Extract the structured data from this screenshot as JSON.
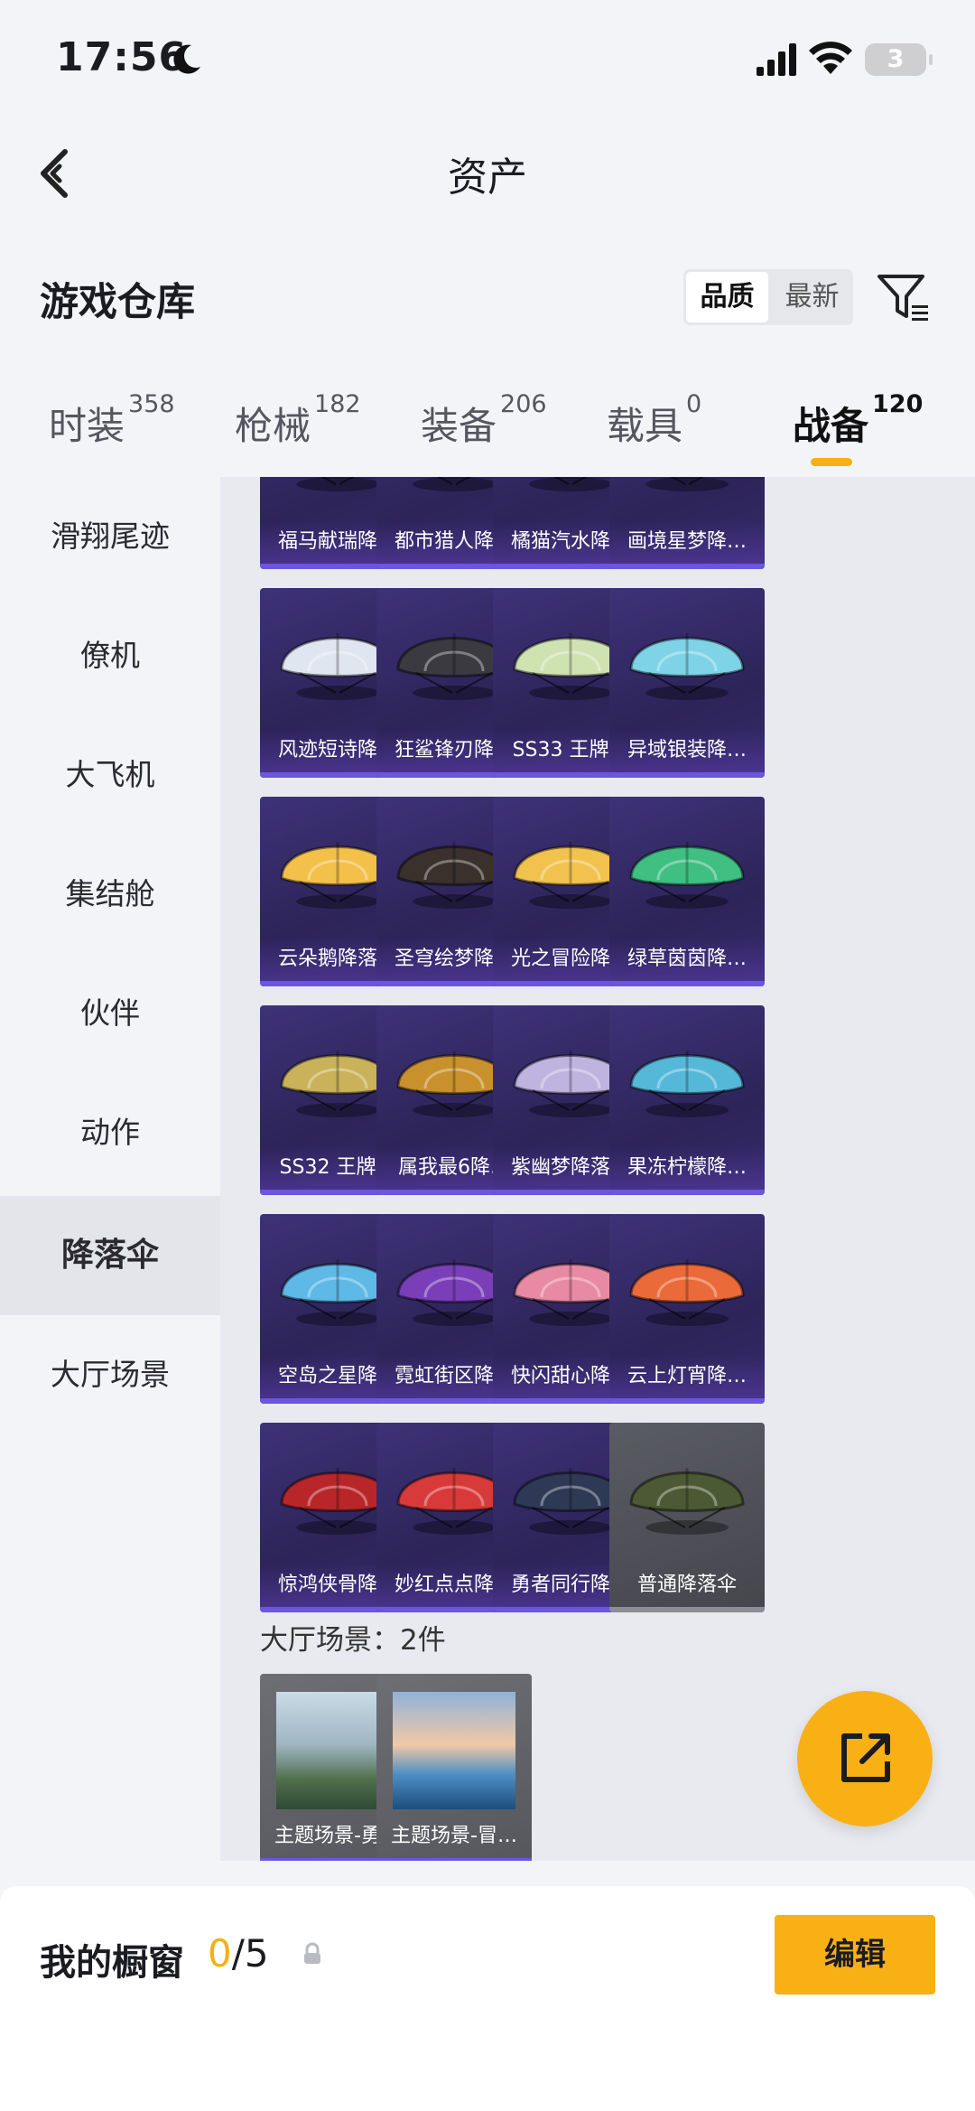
{
  "status_bar": {
    "time": "17:56",
    "battery": "3"
  },
  "nav": {
    "title": "资产"
  },
  "warehouse": {
    "title": "游戏仓库",
    "sort_options": [
      "品质",
      "最新"
    ],
    "sort_selected": "品质"
  },
  "tabs": [
    {
      "label": "时装",
      "count": "358"
    },
    {
      "label": "枪械",
      "count": "182"
    },
    {
      "label": "装备",
      "count": "206"
    },
    {
      "label": "载具",
      "count": "0"
    },
    {
      "label": "战备",
      "count": "120",
      "active": true
    }
  ],
  "sidebar": {
    "items": [
      {
        "label": "滑翔尾迹"
      },
      {
        "label": "僚机"
      },
      {
        "label": "大飞机"
      },
      {
        "label": "集结舱"
      },
      {
        "label": "伙伴"
      },
      {
        "label": "动作"
      },
      {
        "label": "降落伞",
        "active": true
      },
      {
        "label": "大厅场景"
      }
    ]
  },
  "parachutes": {
    "items": [
      {
        "name": "福马献瑞降…",
        "color": "#d9903a"
      },
      {
        "name": "都市猎人降…",
        "color": "#454048"
      },
      {
        "name": "橘猫汽水降…",
        "color": "#e0e0e8"
      },
      {
        "name": "画境星梦降…",
        "color": "#c48a4a"
      },
      {
        "name": "风迹短诗降…",
        "color": "#dfe6ef"
      },
      {
        "name": "狂鲨锋刃降…",
        "color": "#3b3a40"
      },
      {
        "name": "SS33 王牌…",
        "color": "#cfe3b2"
      },
      {
        "name": "异域银装降…",
        "color": "#7fd3e6"
      },
      {
        "name": "云朵鹅降落伞",
        "color": "#f3c04a"
      },
      {
        "name": "圣穹绘梦降…",
        "color": "#3a302c"
      },
      {
        "name": "光之冒险降…",
        "color": "#f2c24e"
      },
      {
        "name": "绿草茵茵降…",
        "color": "#3fbf82"
      },
      {
        "name": "SS32 王牌…",
        "color": "#c9b25a"
      },
      {
        "name": "属我最6降…",
        "color": "#c9912e"
      },
      {
        "name": "紫幽梦降落伞",
        "color": "#bfb4e0"
      },
      {
        "name": "果冻柠檬降…",
        "color": "#56b8d8"
      },
      {
        "name": "空岛之星降…",
        "color": "#5fb9e6"
      },
      {
        "name": "霓虹街区降…",
        "color": "#7a3fb8"
      },
      {
        "name": "快闪甜心降…",
        "color": "#e88aa3"
      },
      {
        "name": "云上灯宵降…",
        "color": "#ea6a3a"
      },
      {
        "name": "惊鸿侠骨降…",
        "color": "#b8262a"
      },
      {
        "name": "妙红点点降…",
        "color": "#d83a3a"
      },
      {
        "name": "勇者同行降…",
        "color": "#2e3a55"
      },
      {
        "name": "普通降落伞",
        "color": "#4b5a34",
        "grey": true
      }
    ]
  },
  "lobby_scenes": {
    "title": "大厅场景：2件",
    "items": [
      {
        "name": "主题场景-勇…"
      },
      {
        "name": "主题场景-冒…"
      }
    ]
  },
  "showcase": {
    "label": "我的橱窗",
    "current": "0",
    "total": "/5",
    "edit_label": "编辑"
  }
}
